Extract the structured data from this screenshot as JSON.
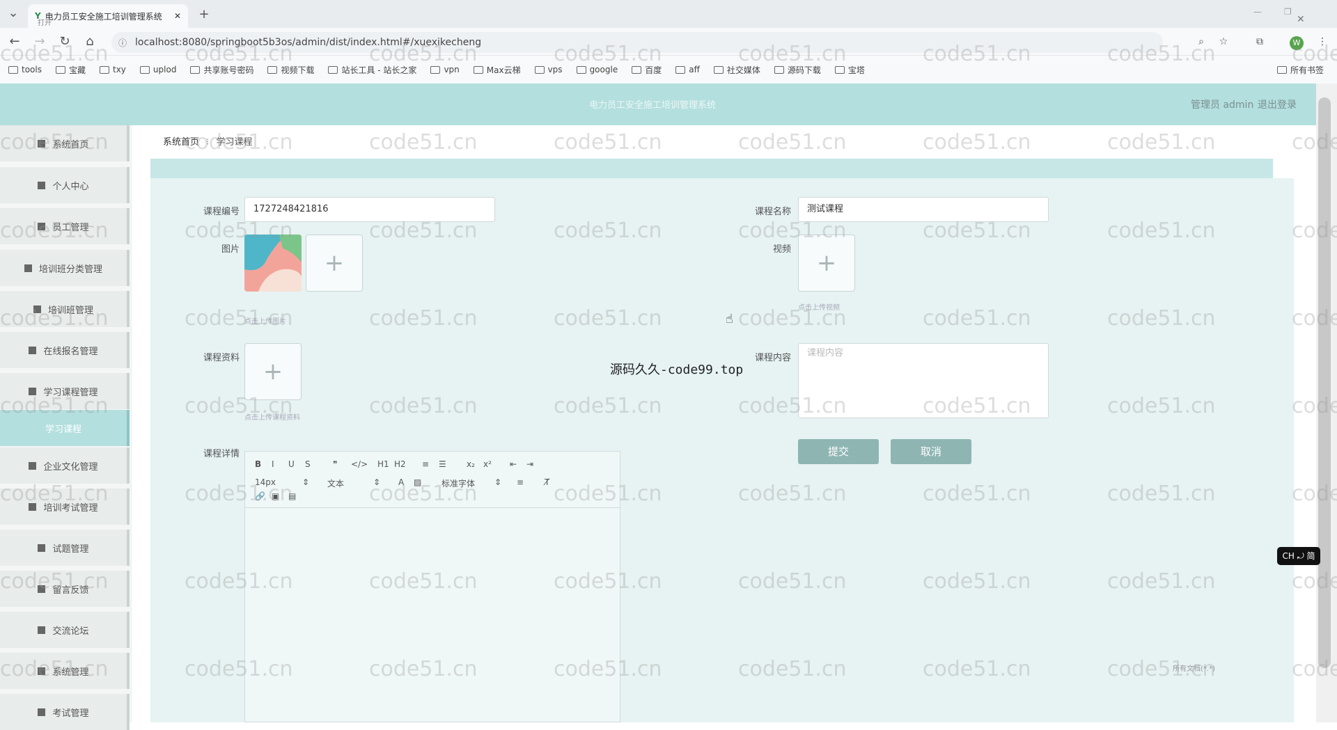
{
  "browser": {
    "tab_title": "电力员工安全施工培训管理系统",
    "tab_sub": "打开",
    "url": "localhost:8080/springboot5b3os/admin/dist/index.html#/xuexikecheng",
    "bookmarks": [
      "tools",
      "宝藏",
      "txy",
      "uplod",
      "共享账号密码",
      "视频下载",
      "站长工具 - 站长之家",
      "vpn",
      "Max云梯",
      "vps",
      "google",
      "百度",
      "aff",
      "社交媒体",
      "源码下载",
      "宝塔"
    ],
    "all_bookmarks": "所有书签",
    "profile_initial": "W"
  },
  "header": {
    "title": "电力员工安全施工培训管理系统",
    "admin_label": "管理员 admin",
    "logout": "退出登录"
  },
  "sidebar": {
    "items": [
      {
        "label": "系统首页",
        "icon": "home-icon"
      },
      {
        "label": "个人中心",
        "icon": "user-icon"
      },
      {
        "label": "员工管理",
        "icon": "grid-icon"
      },
      {
        "label": "培训班分类管理",
        "icon": "grid-icon"
      },
      {
        "label": "培训班管理",
        "icon": "clipboard-icon"
      },
      {
        "label": "在线报名管理",
        "icon": "grid-icon"
      },
      {
        "label": "学习课程管理",
        "icon": "print-icon"
      },
      {
        "label": "学习课程",
        "icon": ""
      },
      {
        "label": "企业文化管理",
        "icon": "briefcase-icon"
      },
      {
        "label": "培训考试管理",
        "icon": "chart-icon"
      },
      {
        "label": "试题管理",
        "icon": "monitor-icon"
      },
      {
        "label": "留言反馈",
        "icon": "grid-icon"
      },
      {
        "label": "交流论坛",
        "icon": "grid-icon"
      },
      {
        "label": "系统管理",
        "icon": "clipboard-icon"
      },
      {
        "label": "考试管理",
        "icon": "grid-icon"
      }
    ]
  },
  "breadcrumb": {
    "home": "系统首页",
    "sep": "⁝",
    "current": "学习课程"
  },
  "form": {
    "code_label": "课程编号",
    "code_value": "1727248421816",
    "name_label": "课程名称",
    "name_value": "测试课程",
    "image_label": "图片",
    "image_hint": "点击上传图片",
    "video_label": "视频",
    "video_hint": "点击上传视频",
    "material_label": "课程资料",
    "material_hint": "点击上传课程资料",
    "content_label": "课程内容",
    "content_placeholder": "课程内容",
    "detail_label": "课程详情",
    "submit": "提交",
    "cancel": "取消"
  },
  "editor": {
    "font_size": "14px",
    "text_style": "文本",
    "font_family": "标准字体",
    "tools_row1": [
      "B",
      "I",
      "U",
      "S",
      "❞",
      "</>",
      "H1",
      "H2",
      "≡",
      "☰",
      "x₂",
      "x²",
      "⇤",
      "⇥"
    ]
  },
  "overlay_text": "源码久久-code99.top",
  "watermark": "code51.cn",
  "ime_badge": "CH ⤾ 简",
  "all_files": "所有文档(*.*)",
  "colors": {
    "accent": "#b3dfde",
    "button": "#8fb5b3",
    "panel": "#e6f3f2"
  }
}
